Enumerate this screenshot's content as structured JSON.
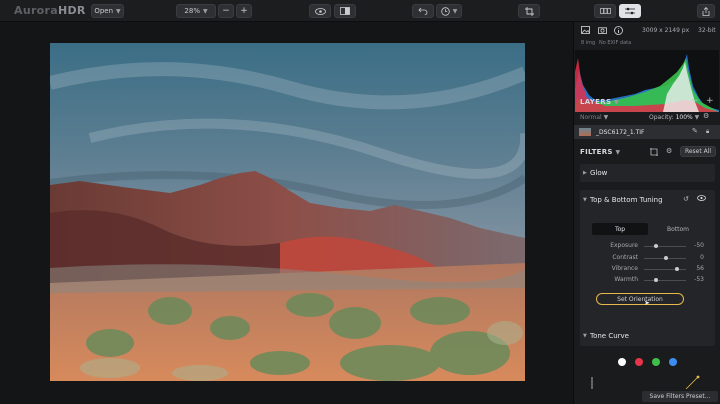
{
  "app": {
    "logo_prefix": "Aurora",
    "logo_suffix": "HDR"
  },
  "toolbar": {
    "open_label": "Open",
    "zoom_value": "28%",
    "zoom_out_symbol": "−",
    "zoom_in_symbol": "+"
  },
  "panel": {
    "image_info": "3009 x 2149 px",
    "bit_depth": "32-bit",
    "format": "8 img",
    "exif": "No EXIF data",
    "layers_title": "LAYERS",
    "blend_mode": "Normal",
    "opacity_label": "Opacity:",
    "opacity_value": "100%",
    "layer_name": "_DSC6172_1.TIF",
    "filters_title": "FILTERS",
    "reset_all": "Reset All",
    "glow_title": "Glow",
    "tb_title": "Top & Bottom Tuning",
    "tab_top": "Top",
    "tab_bottom": "Bottom",
    "sliders": [
      {
        "label": "Exposure",
        "value": "-50",
        "level": 0.25
      },
      {
        "label": "Contrast",
        "value": "0",
        "level": 0.5
      },
      {
        "label": "Vibrance",
        "value": "56",
        "level": 0.78
      },
      {
        "label": "Warmth",
        "value": "-53",
        "level": 0.24
      }
    ],
    "set_orientation": "Set Orientation",
    "tone_curve_title": "Tone Curve",
    "channel_colors": [
      "#ffffff",
      "#e8344a",
      "#3fbf4a",
      "#3b8ef0"
    ],
    "save_preset": "Save Filters Preset..."
  },
  "colors": {
    "accent": "#e7b84a",
    "active_button": "#e0e2e5"
  }
}
